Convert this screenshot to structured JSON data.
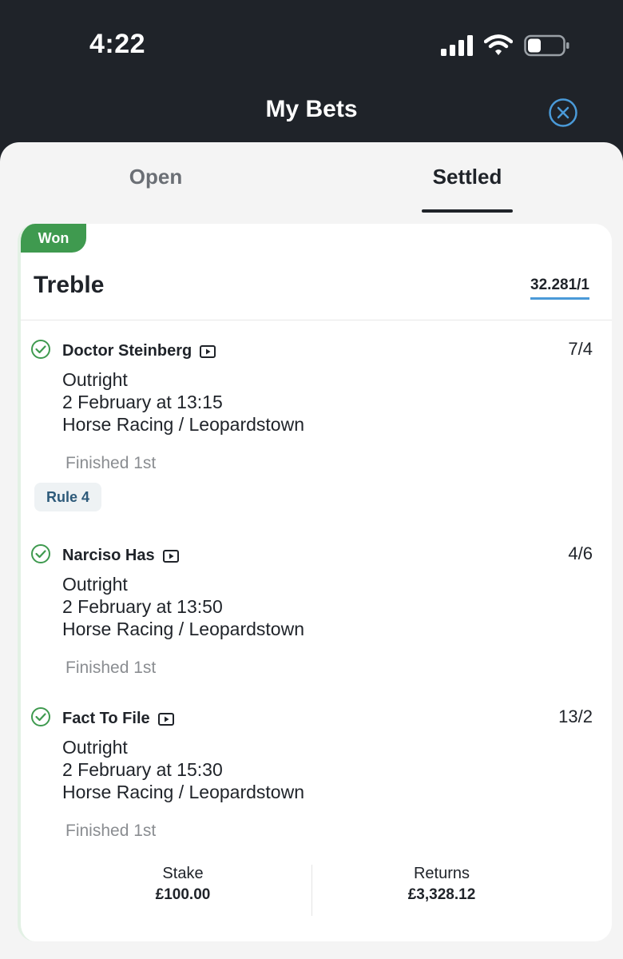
{
  "status_bar": {
    "time": "4:22",
    "icons": [
      "signal-icon",
      "wifi-icon",
      "battery-icon"
    ]
  },
  "header": {
    "title": "My Bets",
    "close_icon": "close-icon"
  },
  "tabs": [
    {
      "label": "Open",
      "active": false
    },
    {
      "label": "Settled",
      "active": true
    }
  ],
  "bet": {
    "status": "Won",
    "type": "Treble",
    "total_odds": "32.281/1",
    "selections": [
      {
        "name": "Doctor Steinberg",
        "odds": "7/4",
        "market": "Outright",
        "datetime": "2 February at 13:15",
        "event": "Horse Racing / Leopardstown",
        "result": "Finished 1st",
        "rule": "Rule 4"
      },
      {
        "name": "Narciso Has",
        "odds": "4/6",
        "market": "Outright",
        "datetime": "2 February at 13:50",
        "event": "Horse Racing / Leopardstown",
        "result": "Finished 1st"
      },
      {
        "name": "Fact To File",
        "odds": "13/2",
        "market": "Outright",
        "datetime": "2 February at 15:30",
        "event": "Horse Racing / Leopardstown",
        "result": "Finished 1st"
      }
    ],
    "stake_label": "Stake",
    "stake_value": "£100.00",
    "returns_label": "Returns",
    "returns_value": "£3,328.12"
  },
  "colors": {
    "header_bg": "#1f2329",
    "won_green": "#3f9a4f",
    "odds_underline": "#4a9ad8",
    "rule_text": "#2d5a7a"
  }
}
